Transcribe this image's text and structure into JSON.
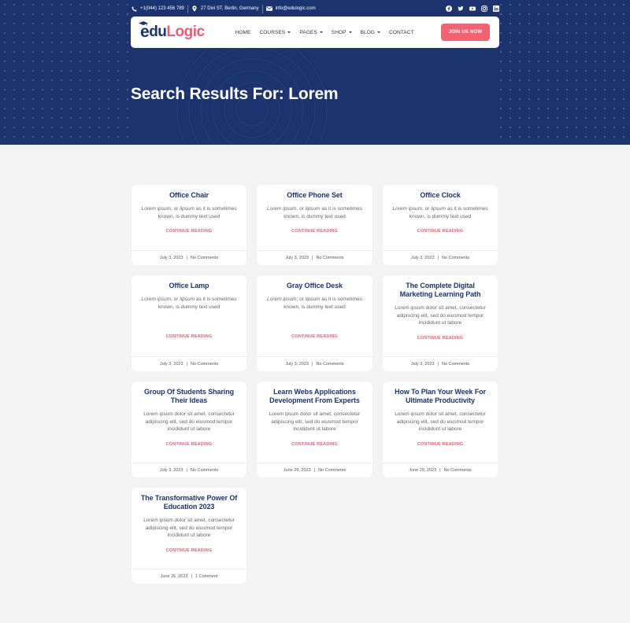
{
  "topbar": {
    "phone": "+1(044) 123 456 789",
    "address": "27 Divi ST, Berlin, Germany",
    "email": "info@edulogic.com",
    "social_icons": [
      "facebook-icon",
      "twitter-icon",
      "youtube-icon",
      "instagram-icon",
      "linkedin-icon"
    ]
  },
  "logo": {
    "part1": "e",
    "part2": "du",
    "part3": "Logic"
  },
  "nav": {
    "items": [
      {
        "label": "HOME",
        "dropdown": false
      },
      {
        "label": "COURSES",
        "dropdown": true
      },
      {
        "label": "PAGES",
        "dropdown": true
      },
      {
        "label": "SHOP",
        "dropdown": true
      },
      {
        "label": "BLOG",
        "dropdown": true
      },
      {
        "label": "CONTACT",
        "dropdown": false
      }
    ],
    "cta": "JOIN US NOW"
  },
  "hero": {
    "title": "Search Results For: Lorem"
  },
  "colors": {
    "navy": "#1b3470",
    "accent": "#f15b71",
    "background": "#f3f3f3"
  },
  "read_more": "CONTINUE READING",
  "posts": [
    {
      "title": "Office Chair",
      "excerpt_italic": "Lorem ipsum",
      "excerpt_mid": ", or ",
      "excerpt_italic2": "lipsum",
      "excerpt_rest": " as it is sometimes known, is dummy text used",
      "date": "July 3, 2023",
      "comments": "No Comments"
    },
    {
      "title": "Office Phone Set",
      "excerpt_italic": "Lorem ipsum",
      "excerpt_mid": ", or ",
      "excerpt_italic2": "lipsum",
      "excerpt_rest": " as it is sometimes known, is dummy text used",
      "date": "July 3, 2023",
      "comments": "No Comments"
    },
    {
      "title": "Office Clock",
      "excerpt_italic": "Lorem ipsum",
      "excerpt_mid": ", or ",
      "excerpt_italic2": "lipsum",
      "excerpt_rest": " as it is sometimes known, is dummy text used",
      "date": "July 3, 2023",
      "comments": "No Comments"
    },
    {
      "title": "Office Lamp",
      "excerpt_italic": "Lorem ipsum",
      "excerpt_mid": ", or ",
      "excerpt_italic2": "lipsum",
      "excerpt_rest": " as it is sometimes known, is dummy text used",
      "date": "July 3, 2023",
      "comments": "No Comments"
    },
    {
      "title": "Gray Office Desk",
      "excerpt_italic": "Lorem ipsum",
      "excerpt_mid": ", or ",
      "excerpt_italic2": "lipsum",
      "excerpt_rest": " as it is sometimes known, is dummy text used",
      "date": "July 3, 2023",
      "comments": "No Comments"
    },
    {
      "title": "The Complete Digital Marketing Learning Path",
      "excerpt": "Lorem ipsum dolor sit amet, consectetur adipiscing elit, sed do eiusmod tempor incididunt ut labore",
      "date": "July 3, 2023",
      "comments": "No Comments"
    },
    {
      "title": "Group Of Students Sharing Their Ideas",
      "excerpt": "Lorem ipsum dolor sit amet, consectetur adipiscing elit, sed do eiusmod tempor incididunt ut labore",
      "date": "July 3, 2023",
      "comments": "No Comments"
    },
    {
      "title": "Learn Webs Applications Development From Experts",
      "excerpt": "Lorem ipsum dolor sit amet, consectetur adipiscing elit, sed do eiusmod tempor incididunt ut labore",
      "date": "June 29, 2023",
      "comments": "No Comments"
    },
    {
      "title": "How To Plan Your Week For Ultimate Productivity",
      "excerpt": "Lorem ipsum dolor sit amet, consectetur adipiscing elit, sed do eiusmod tempor incididunt ut labore",
      "date": "June 29, 2023",
      "comments": "No Comments"
    },
    {
      "title": "The Transformative Power Of Education 2023",
      "excerpt": "Lorem ipsum dolor sit amet, consectetur adipiscing elit, sed do eiusmod tempor incididunt ut labore",
      "date": "June 26, 2023",
      "comments": "1 Comment"
    }
  ]
}
